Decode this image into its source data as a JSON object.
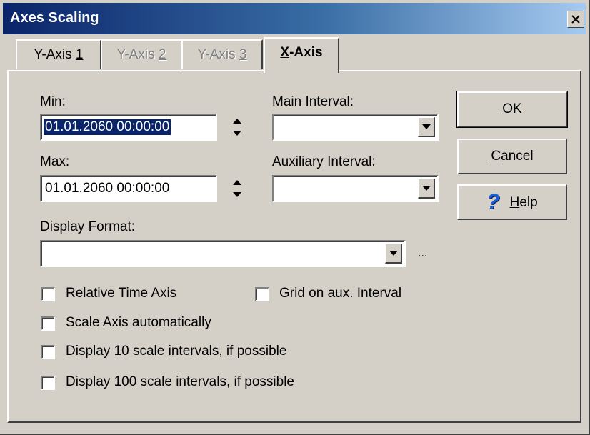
{
  "window": {
    "title": "Axes Scaling"
  },
  "tabs": [
    {
      "label": "Y-Axis ",
      "accel": "1",
      "state": "normal"
    },
    {
      "label": "Y-Axis ",
      "accel": "2",
      "state": "disabled"
    },
    {
      "label": "Y-Axis ",
      "accel": "3",
      "state": "disabled"
    },
    {
      "accel": "X",
      "label": "-Axis",
      "state": "active"
    }
  ],
  "form": {
    "min": {
      "label": "Min:",
      "value": "01.01.2060 00:00:00",
      "selected": true
    },
    "max": {
      "label": "Max:",
      "value": "01.01.2060 00:00:00"
    },
    "main_interval": {
      "label": "Main Interval:",
      "value": ""
    },
    "aux_interval": {
      "label": "Auxiliary Interval:",
      "value": ""
    },
    "display_format": {
      "label": "Display Format:",
      "value": "",
      "more": "..."
    }
  },
  "buttons": {
    "ok": {
      "accel": "O",
      "rest": "K"
    },
    "cancel": {
      "accel": "C",
      "rest": "ancel"
    },
    "help": {
      "icon": "question-icon",
      "accel": "H",
      "rest": "elp",
      "glyph": "?"
    }
  },
  "checkboxes": [
    {
      "label": "Relative Time Axis",
      "checked": false
    },
    {
      "label": "Grid on aux. Interval",
      "checked": false
    },
    {
      "label": "Scale Axis automatically",
      "checked": false
    },
    {
      "label": "Display 10 scale intervals, if possible",
      "checked": false
    },
    {
      "label": "Display 100 scale intervals, if possible",
      "checked": false
    }
  ],
  "colors": {
    "title_bar": "#0a246a",
    "face": "#d4d0c8",
    "selection": "#0a246a",
    "help_icon": "#1a5fd0"
  }
}
